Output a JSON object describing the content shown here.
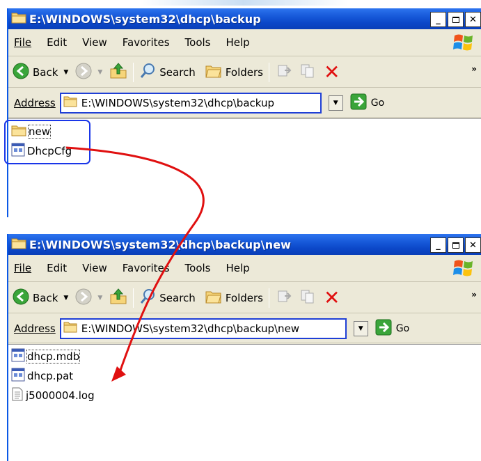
{
  "windows": [
    {
      "title": "E:\\WINDOWS\\system32\\dhcp\\backup",
      "menu": [
        "File",
        "Edit",
        "View",
        "Favorites",
        "Tools",
        "Help"
      ],
      "toolbar": {
        "back": "Back",
        "search": "Search",
        "folders": "Folders"
      },
      "address": {
        "label": "Address",
        "path": "E:\\WINDOWS\\system32\\dhcp\\backup",
        "go": "Go"
      },
      "files": [
        {
          "name": "new",
          "icon": "folder-icon"
        },
        {
          "name": "DhcpCfg",
          "icon": "file-icon"
        }
      ]
    },
    {
      "title": "E:\\WINDOWS\\system32\\dhcp\\backup\\new",
      "menu": [
        "File",
        "Edit",
        "View",
        "Favorites",
        "Tools",
        "Help"
      ],
      "toolbar": {
        "back": "Back",
        "search": "Search",
        "folders": "Folders"
      },
      "address": {
        "label": "Address",
        "path": "E:\\WINDOWS\\system32\\dhcp\\backup\\new",
        "go": "Go"
      },
      "files": [
        {
          "name": "dhcp.mdb",
          "icon": "file-icon"
        },
        {
          "name": "dhcp.pat",
          "icon": "file-icon"
        },
        {
          "name": "j5000004.log",
          "icon": "text-file-icon"
        }
      ]
    }
  ],
  "colors": {
    "title_bar": "#0b47c8",
    "highlight": "#1a36e8",
    "arrow": "#e01010"
  }
}
